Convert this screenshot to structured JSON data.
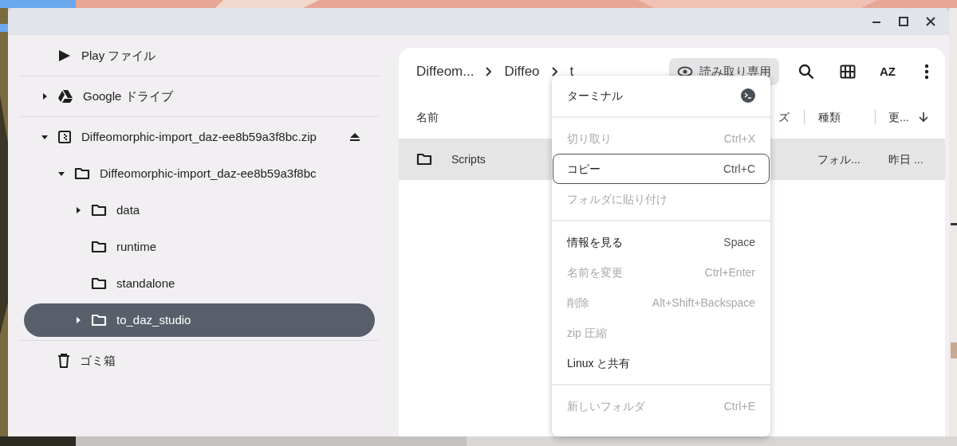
{
  "sidebar": {
    "items": [
      {
        "label": "Play ファイル",
        "kind": "play",
        "has_children": false,
        "expanded": false,
        "selected": false
      },
      {
        "label": "Google ドライブ",
        "kind": "drive",
        "has_children": true,
        "expanded": false,
        "selected": false
      },
      {
        "label": "Diffeomorphic-import_daz-ee8b59a3f8bc.zip",
        "kind": "zip",
        "has_children": true,
        "expanded": true,
        "selected": false,
        "eject": true,
        "children": [
          {
            "label": "Diffeomorphic-import_daz-ee8b59a3f8bc",
            "kind": "folder",
            "has_children": true,
            "expanded": true,
            "selected": false,
            "children": [
              {
                "label": "data",
                "kind": "folder",
                "has_children": true,
                "expanded": false,
                "selected": false
              },
              {
                "label": "runtime",
                "kind": "folder",
                "has_children": false,
                "expanded": false,
                "selected": false
              },
              {
                "label": "standalone",
                "kind": "folder",
                "has_children": false,
                "expanded": false,
                "selected": false
              },
              {
                "label": "to_daz_studio",
                "kind": "folder",
                "has_children": true,
                "expanded": false,
                "selected": true
              }
            ]
          }
        ]
      },
      {
        "label": "ゴミ箱",
        "kind": "trash",
        "has_children": false,
        "expanded": false,
        "selected": false
      }
    ]
  },
  "toolbar": {
    "breadcrumbs": [
      "Diffeom...",
      "Diffeo",
      "t"
    ],
    "readonly_label": "読み取り専用",
    "sort_label": "AZ"
  },
  "table": {
    "columns": [
      "名前",
      "ズ",
      "種類",
      "更..."
    ],
    "rows": [
      {
        "cells": [
          "Scripts",
          "",
          "フォル...",
          "昨日 ..."
        ],
        "selected": true
      }
    ]
  },
  "menu": {
    "groups": [
      [
        {
          "label": "ターミナル",
          "kind": "app",
          "disabled": false,
          "focused": false
        }
      ],
      [
        {
          "label": "切り取り",
          "shortcut": "Ctrl+X",
          "kind": "command",
          "disabled": true,
          "focused": false
        },
        {
          "label": "コピー",
          "shortcut": "Ctrl+C",
          "kind": "command",
          "disabled": false,
          "focused": true
        },
        {
          "label": "フォルダに貼り付け",
          "kind": "command",
          "disabled": true,
          "focused": false
        }
      ],
      [
        {
          "label": "情報を見る",
          "shortcut": "Space",
          "kind": "command",
          "disabled": false,
          "focused": false
        },
        {
          "label": "名前を変更",
          "shortcut": "Ctrl+Enter",
          "kind": "command",
          "disabled": true,
          "focused": false
        },
        {
          "label": "削除",
          "shortcut": "Alt+Shift+Backspace",
          "kind": "command",
          "disabled": true,
          "focused": false
        },
        {
          "label": "zip 圧縮",
          "kind": "command",
          "disabled": true,
          "focused": false
        },
        {
          "label": "Linux と共有",
          "kind": "command",
          "disabled": false,
          "focused": false
        }
      ],
      [
        {
          "label": "新しいフォルダ",
          "shortcut": "Ctrl+E",
          "kind": "command",
          "disabled": true,
          "focused": false
        }
      ]
    ]
  }
}
